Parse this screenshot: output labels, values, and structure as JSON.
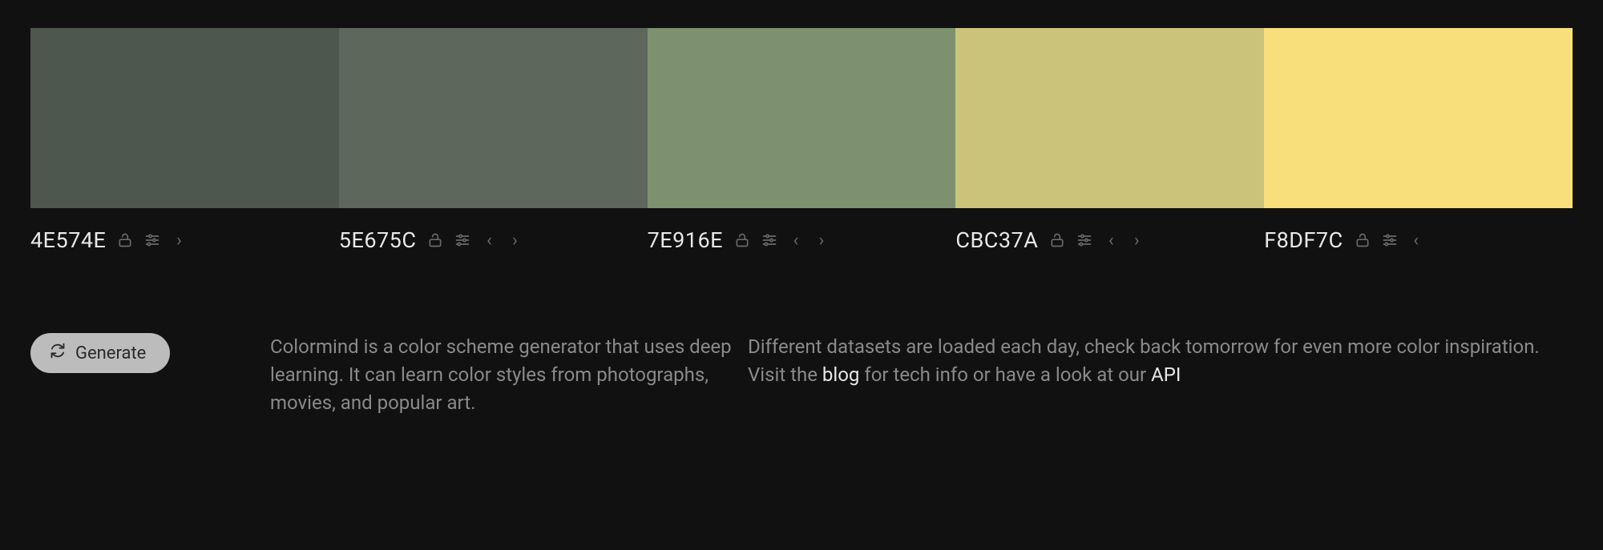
{
  "palette": [
    {
      "hex": "4E574E",
      "color": "#4E574E",
      "controls": [
        "lock",
        "sliders",
        "right"
      ]
    },
    {
      "hex": "5E675C",
      "color": "#5E675C",
      "controls": [
        "lock",
        "sliders",
        "left",
        "right"
      ]
    },
    {
      "hex": "7E916E",
      "color": "#7E916E",
      "controls": [
        "lock",
        "sliders",
        "left",
        "right"
      ]
    },
    {
      "hex": "CBC37A",
      "color": "#CBC37A",
      "controls": [
        "lock",
        "sliders",
        "left",
        "right"
      ]
    },
    {
      "hex": "F8DF7C",
      "color": "#F8DF7C",
      "controls": [
        "lock",
        "sliders",
        "left"
      ]
    }
  ],
  "generate_label": "Generate",
  "desc1": "Colormind is a color scheme generator that uses deep learning. It can learn color styles from photographs, movies, and popular art.",
  "desc2_a": "Different datasets are loaded each day, check back tomorrow for even more color inspiration. Visit the ",
  "desc2_blog": "blog",
  "desc2_b": " for tech info or have a look at our ",
  "desc2_api": "API"
}
